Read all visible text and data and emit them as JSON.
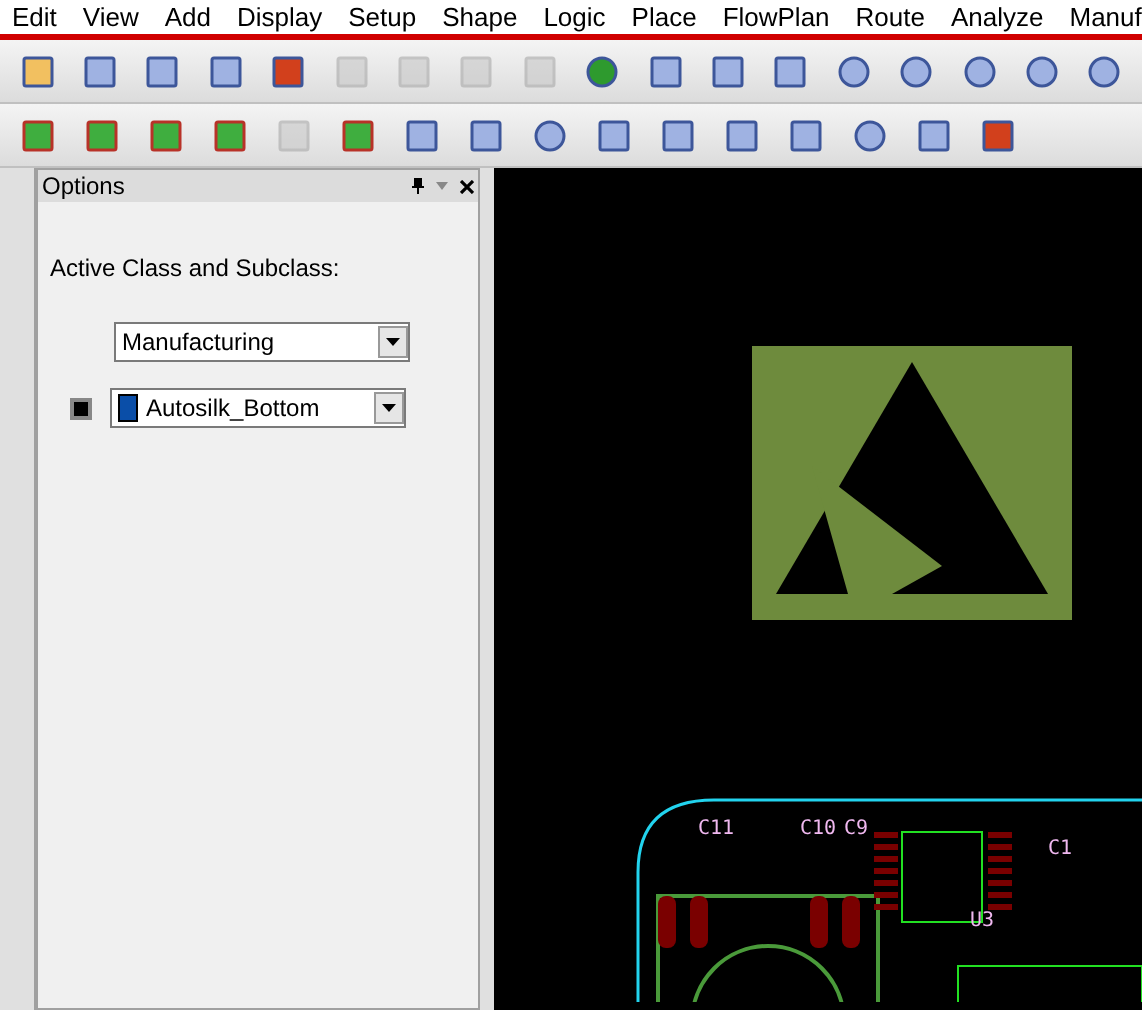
{
  "menu": [
    "Edit",
    "View",
    "Add",
    "Display",
    "Setup",
    "Shape",
    "Logic",
    "Place",
    "FlowPlan",
    "Route",
    "Analyze",
    "Manuf"
  ],
  "toolbars": [
    {
      "buttons": [
        {
          "disabled": false
        },
        {
          "disabled": false
        },
        {
          "disabled": false
        },
        {
          "disabled": false
        },
        {
          "disabled": false
        },
        {
          "disabled": true
        },
        {
          "disabled": true
        },
        {
          "disabled": true
        },
        {
          "disabled": true
        },
        {
          "disabled": false
        },
        {
          "disabled": false
        },
        {
          "disabled": false
        },
        {
          "disabled": false
        },
        {
          "disabled": false
        },
        {
          "disabled": false
        },
        {
          "disabled": false
        },
        {
          "disabled": false
        },
        {
          "disabled": false
        }
      ]
    },
    {
      "buttons": [
        {
          "disabled": false
        },
        {
          "disabled": false
        },
        {
          "disabled": false
        },
        {
          "disabled": false
        },
        {
          "disabled": true
        },
        {
          "disabled": false
        },
        {
          "disabled": false
        },
        {
          "disabled": false
        },
        {
          "disabled": false
        },
        {
          "disabled": false
        },
        {
          "disabled": false
        },
        {
          "disabled": false
        },
        {
          "disabled": false
        },
        {
          "disabled": false
        },
        {
          "disabled": false
        },
        {
          "disabled": false
        }
      ]
    }
  ],
  "options_panel": {
    "title": "Options",
    "label": "Active Class and Subclass:",
    "class_select": {
      "value": "Manufacturing"
    },
    "subclass_select": {
      "value": "Autosilk_Bottom",
      "color": "#0a4ea8"
    }
  },
  "pcb_labels": [
    "C11",
    "C10",
    "C9",
    "C1",
    "U3"
  ]
}
